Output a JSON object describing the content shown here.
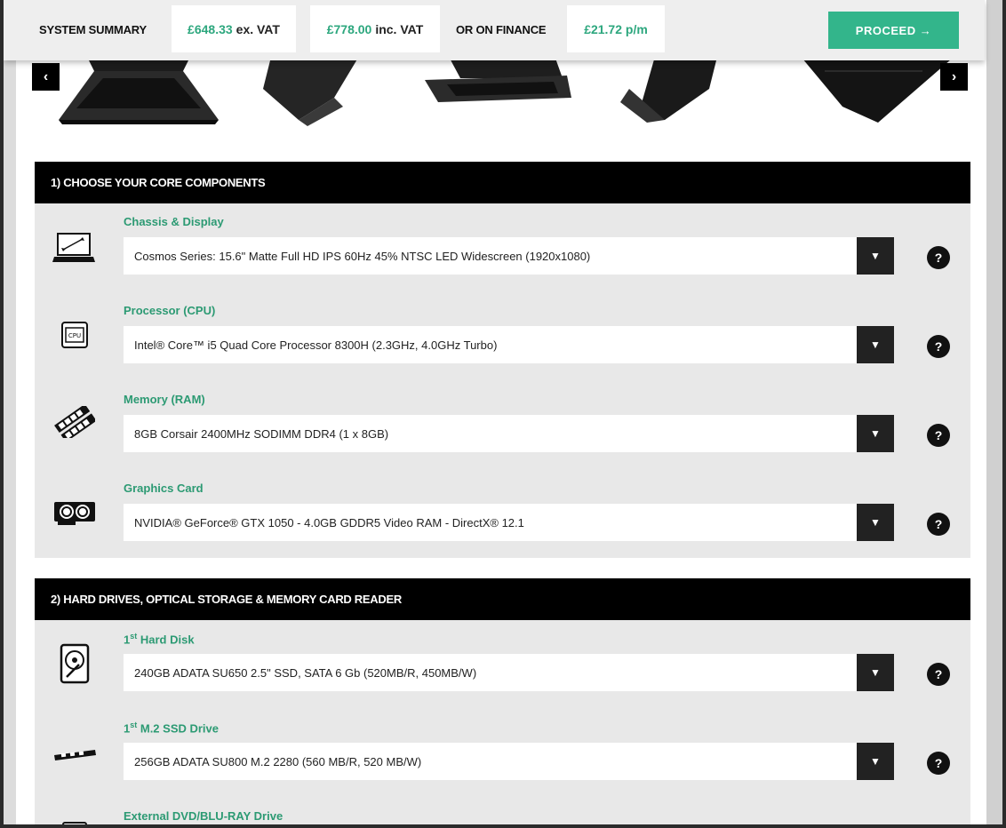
{
  "summary": {
    "label": "SYSTEM SUMMARY",
    "price_ex": "£648.33",
    "ex_suffix": "ex. VAT",
    "price_inc": "£778.00",
    "inc_suffix": "inc. VAT",
    "finance_label": "OR ON FINANCE",
    "finance_value": "£21.72 p/m",
    "proceed": "PROCEED →"
  },
  "gallery": {
    "prev": "‹",
    "next": "›"
  },
  "sections": [
    {
      "title": "1) CHOOSE YOUR CORE COMPONENTS",
      "options": [
        {
          "title": "Chassis & Display",
          "value": "Cosmos Series: 15.6\" Matte Full HD IPS 60Hz 45% NTSC LED Widescreen (1920x1080)",
          "icon": "laptop-icon"
        },
        {
          "title": "Processor (CPU)",
          "value": "Intel® Core™ i5 Quad Core Processor 8300H (2.3GHz, 4.0GHz Turbo)",
          "icon": "cpu-icon"
        },
        {
          "title": "Memory (RAM)",
          "value": "8GB Corsair 2400MHz SODIMM DDR4 (1 x 8GB)",
          "icon": "ram-icon"
        },
        {
          "title": "Graphics Card",
          "value": "NVIDIA® GeForce® GTX 1050 - 4.0GB GDDR5 Video RAM - DirectX® 12.1",
          "icon": "gpu-icon"
        }
      ]
    },
    {
      "title": "2) HARD DRIVES, OPTICAL STORAGE & MEMORY CARD READER",
      "options": [
        {
          "title_pre": "1",
          "title_sup": "st",
          "title_post": " Hard Disk",
          "value": "240GB ADATA SU650 2.5\" SSD, SATA 6 Gb (520MB/R, 450MB/W)",
          "icon": "hdd-icon"
        },
        {
          "title_pre": "1",
          "title_sup": "st",
          "title_post": " M.2 SSD Drive",
          "value": "256GB ADATA SU800 M.2 2280 (560 MB/R, 520 MB/W)",
          "icon": "m2-ssd-icon"
        },
        {
          "title": "External DVD/BLU-RAY Drive",
          "icon": "optical-drive-icon"
        }
      ]
    }
  ],
  "dropdown_glyph": "▼",
  "help_glyph": "?",
  "colors": {
    "accent": "#33b58b",
    "accent_text": "#2c9a73",
    "header": "#000000",
    "panel": "#e8e8e8"
  }
}
